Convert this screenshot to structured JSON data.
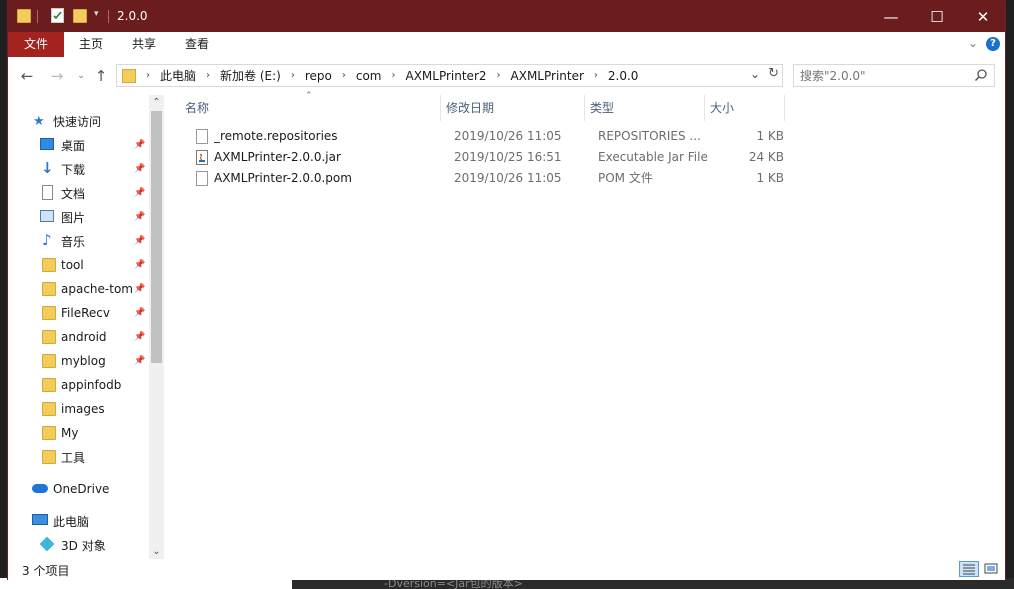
{
  "window": {
    "title": "2.0.0",
    "controls": {
      "minimize": "—",
      "maximize": "☐",
      "close": "✕"
    }
  },
  "ribbon": {
    "tabs": [
      {
        "label": "文件",
        "active": true
      },
      {
        "label": "主页"
      },
      {
        "label": "共享"
      },
      {
        "label": "查看"
      }
    ],
    "help": "?"
  },
  "address": {
    "crumbs": [
      "此电脑",
      "新加卷 (E:)",
      "repo",
      "com",
      "AXMLPrinter2",
      "AXMLPrinter",
      "2.0.0"
    ]
  },
  "search": {
    "placeholder": "搜索\"2.0.0\""
  },
  "nav": {
    "quick_access": "快速访问",
    "items": [
      {
        "label": "桌面",
        "icon": "desktop-icon",
        "pinned": true
      },
      {
        "label": "下载",
        "icon": "download-icon",
        "pinned": true
      },
      {
        "label": "文档",
        "icon": "document-icon",
        "pinned": true
      },
      {
        "label": "图片",
        "icon": "pictures-icon",
        "pinned": true
      },
      {
        "label": "音乐",
        "icon": "music-icon",
        "pinned": true
      },
      {
        "label": "tool",
        "icon": "folder-icon",
        "pinned": true
      },
      {
        "label": "apache-tom",
        "icon": "folder-icon",
        "pinned": true
      },
      {
        "label": "FileRecv",
        "icon": "folder-icon",
        "pinned": true
      },
      {
        "label": "android",
        "icon": "folder-icon",
        "pinned": true
      },
      {
        "label": "myblog",
        "icon": "folder-icon",
        "pinned": true
      },
      {
        "label": "appinfodb",
        "icon": "folder-icon",
        "pinned": false
      },
      {
        "label": "images",
        "icon": "folder-icon",
        "pinned": false
      },
      {
        "label": "My",
        "icon": "folder-icon",
        "pinned": false
      },
      {
        "label": "工具",
        "icon": "folder-icon",
        "pinned": false
      }
    ],
    "onedrive": "OneDrive",
    "this_pc": "此电脑",
    "objects_3d": "3D 对象"
  },
  "columns": {
    "name": "名称",
    "modified": "修改日期",
    "type": "类型",
    "size": "大小"
  },
  "files": [
    {
      "name": "_remote.repositories",
      "modified": "2019/10/26 11:05",
      "type": "REPOSITORIES ...",
      "size": "1 KB",
      "icon": "file-icon"
    },
    {
      "name": "AXMLPrinter-2.0.0.jar",
      "modified": "2019/10/25 16:51",
      "type": "Executable Jar File",
      "size": "24 KB",
      "icon": "jar-file-icon"
    },
    {
      "name": "AXMLPrinter-2.0.0.pom",
      "modified": "2019/10/26 11:05",
      "type": "POM 文件",
      "size": "1 KB",
      "icon": "file-icon"
    }
  ],
  "status": {
    "item_count": "3 个项目"
  },
  "background_text": "-Dversion=<Jar包的版本>",
  "colors": {
    "titlebar": "#6b1c1c",
    "file_tab": "#a4231f",
    "header_text": "#4c607a"
  }
}
